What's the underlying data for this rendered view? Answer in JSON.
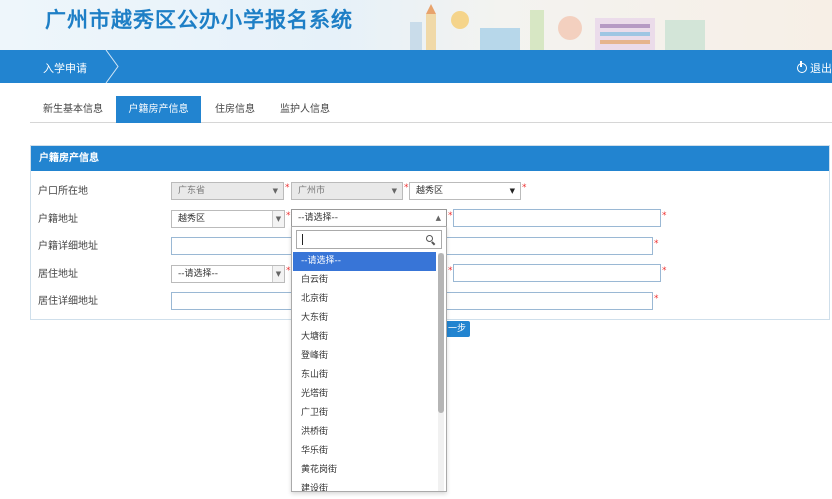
{
  "header": {
    "title": "广州市越秀区公办小学报名系统"
  },
  "nav": {
    "item": "入学申请",
    "logout": "退出"
  },
  "tabs": [
    {
      "label": "新生基本信息",
      "active": false
    },
    {
      "label": "户籍房产信息",
      "active": true
    },
    {
      "label": "住房信息",
      "active": false
    },
    {
      "label": "监护人信息",
      "active": false
    }
  ],
  "panel": {
    "title": "户籍房产信息"
  },
  "form": {
    "hukou_location": {
      "label": "户口所在地",
      "province": "广东省",
      "city": "广州市",
      "district": "越秀区"
    },
    "hukou_address": {
      "label": "户籍地址",
      "district": "越秀区",
      "street": "--请选择--"
    },
    "hukou_detail": {
      "label": "户籍详细地址"
    },
    "residence_address": {
      "label": "居住地址",
      "district": "--请选择--"
    },
    "residence_detail": {
      "label": "居住详细地址"
    },
    "required_mark": "*",
    "next_button": "一步"
  },
  "dropdown": {
    "search_value": "",
    "items": [
      "--请选择--",
      "白云街",
      "北京街",
      "大东街",
      "大塘街",
      "登峰街",
      "东山街",
      "光塔街",
      "广卫街",
      "洪桥街",
      "华乐街",
      "黄花岗街",
      "建设街"
    ],
    "highlighted_index": 0
  },
  "colors": {
    "primary": "#2284d0",
    "highlight": "#3875d7",
    "required": "#ee3333"
  }
}
